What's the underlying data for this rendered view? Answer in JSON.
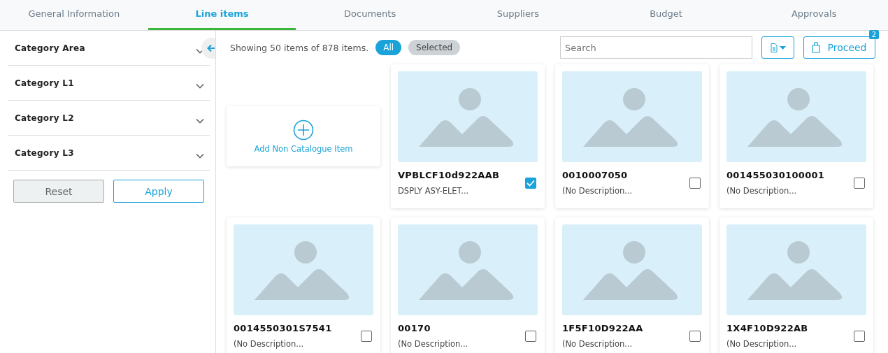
{
  "tabs": [
    {
      "label": "General Information",
      "selected": false
    },
    {
      "label": "Line items",
      "selected": true
    },
    {
      "label": "Documents",
      "selected": false
    },
    {
      "label": "Suppliers",
      "selected": false
    },
    {
      "label": "Budget",
      "selected": false
    },
    {
      "label": "Approvals",
      "selected": false
    }
  ],
  "filters": [
    {
      "label": "Category Area",
      "expanded": false
    },
    {
      "label": "Category L1",
      "expanded": false
    },
    {
      "label": "Category L2",
      "expanded": false
    },
    {
      "label": "Category L3",
      "expanded": false
    }
  ],
  "filter_buttons": {
    "reset": "Reset",
    "apply": "Apply"
  },
  "summary": "Showing 50 items of 878 items.",
  "view_pills": [
    {
      "label": "All",
      "selected": true
    },
    {
      "label": "Selected",
      "selected": false
    }
  ],
  "search": {
    "placeholder": "Search"
  },
  "proceed": {
    "label": "Proceed",
    "badge": "2"
  },
  "add_item": "Add Non Catalogue Item",
  "items": [
    {
      "code": "VPBLCF10d922AAB",
      "description": "DSPLY ASY-ELET...",
      "checked": true
    },
    {
      "code": "0010007050",
      "description": "(No Description...",
      "checked": false
    },
    {
      "code": "001455030100001",
      "description": "(No Description...",
      "checked": false
    },
    {
      "code": "0014550301S7541",
      "description": "(No Description...",
      "checked": false
    },
    {
      "code": "00170",
      "description": "(No Description...",
      "checked": false
    },
    {
      "code": "1F5F10D922AA",
      "description": "(No Description...",
      "checked": false
    },
    {
      "code": "1X4F10D922AB",
      "description": "(No Description...",
      "checked": false
    }
  ]
}
